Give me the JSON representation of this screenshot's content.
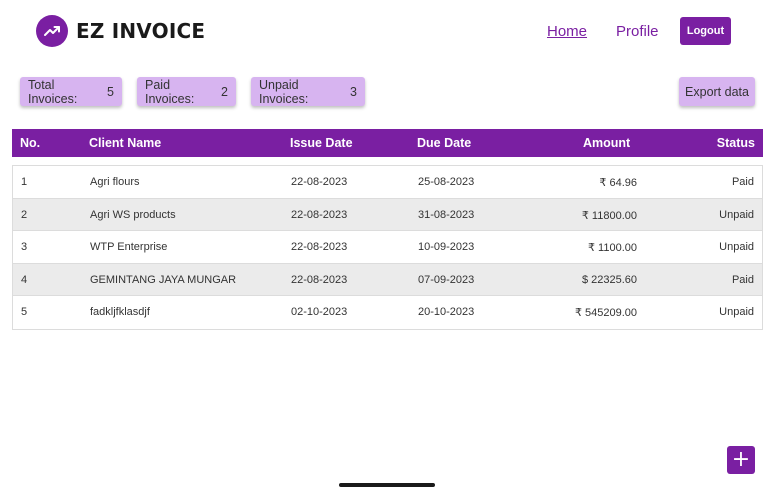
{
  "app": {
    "name": "EZ INVOICE",
    "logo_icon": "trending-up-icon",
    "accent": "#7a1fa2"
  },
  "nav": {
    "home": "Home",
    "profile": "Profile",
    "logout": "Logout"
  },
  "summary": {
    "total_label": "Total Invoices:",
    "total_value": "5",
    "paid_label": "Paid Invoices:",
    "paid_value": "2",
    "unpaid_label": "Unpaid Invoices:",
    "unpaid_value": "3"
  },
  "export_label": "Export data",
  "table": {
    "headers": {
      "no": "No.",
      "client": "Client Name",
      "issue": "Issue Date",
      "due": "Due Date",
      "amount": "Amount",
      "status": "Status"
    },
    "rows": [
      {
        "no": "1",
        "client": "Agri flours",
        "issue": "22-08-2023",
        "due": "25-08-2023",
        "amount": "₹ 64.96",
        "status": "Paid"
      },
      {
        "no": "2",
        "client": "Agri WS products",
        "issue": "22-08-2023",
        "due": "31-08-2023",
        "amount": "₹ 11800.00",
        "status": "Unpaid"
      },
      {
        "no": "3",
        "client": "WTP Enterprise",
        "issue": "22-08-2023",
        "due": "10-09-2023",
        "amount": "₹ 1100.00",
        "status": "Unpaid"
      },
      {
        "no": "4",
        "client": "GEMINTANG JAYA MUNGAR",
        "issue": "22-08-2023",
        "due": "07-09-2023",
        "amount": "$ 22325.60",
        "status": "Paid"
      },
      {
        "no": "5",
        "client": "fadkljfklasdjf",
        "issue": "02-10-2023",
        "due": "20-10-2023",
        "amount": "₹ 545209.00",
        "status": "Unpaid"
      }
    ]
  },
  "add_button": {
    "label": "+",
    "icon": "plus-icon"
  }
}
